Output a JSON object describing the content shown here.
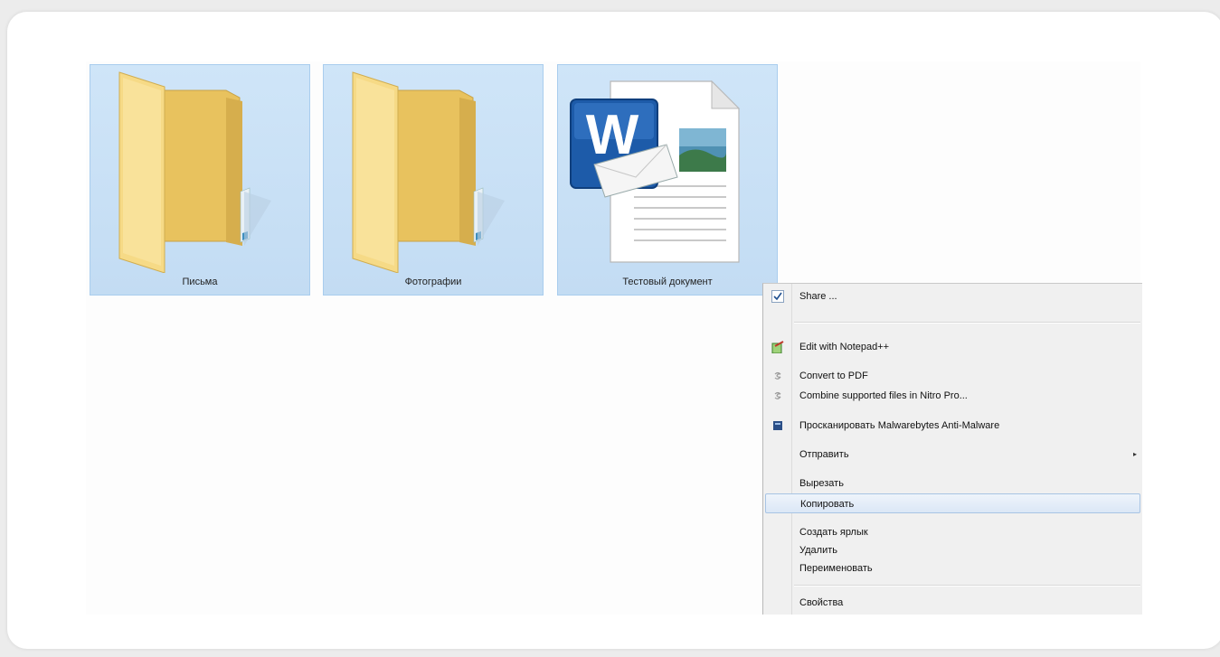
{
  "files": [
    {
      "name": "Письма",
      "icon": "folder-icon"
    },
    {
      "name": "Фотографии",
      "icon": "folder-icon"
    },
    {
      "name": "Тестовый документ",
      "icon": "word-document-icon"
    }
  ],
  "context_menu": {
    "items": [
      {
        "label": "Share ...",
        "icon": "share-check-icon"
      },
      {
        "label": "Edit with Notepad++",
        "icon": "notepad-plus-plus-icon"
      },
      {
        "label": "Convert to PDF",
        "icon": "nitro-pdf-icon"
      },
      {
        "label": "Combine supported files in Nitro Pro...",
        "icon": "nitro-pdf-icon"
      },
      {
        "label": "Просканировать Malwarebytes Anti-Malware",
        "icon": "malwarebytes-icon"
      },
      {
        "label": "Отправить",
        "icon": "submenu-arrow-icon"
      },
      {
        "label": "Вырезать"
      },
      {
        "label": "Копировать",
        "highlighted": true
      },
      {
        "label": "Создать ярлык"
      },
      {
        "label": "Удалить"
      },
      {
        "label": "Переименовать"
      },
      {
        "label": "Свойства"
      }
    ],
    "submenu_arrow": "▸"
  },
  "colors": {
    "selection_fill": "#c8e0f6",
    "selection_border": "#a9cdee",
    "menu_background": "#f0f0f0",
    "folder_yellow": "#f4d57e",
    "word_blue": "#1d5ba9"
  }
}
